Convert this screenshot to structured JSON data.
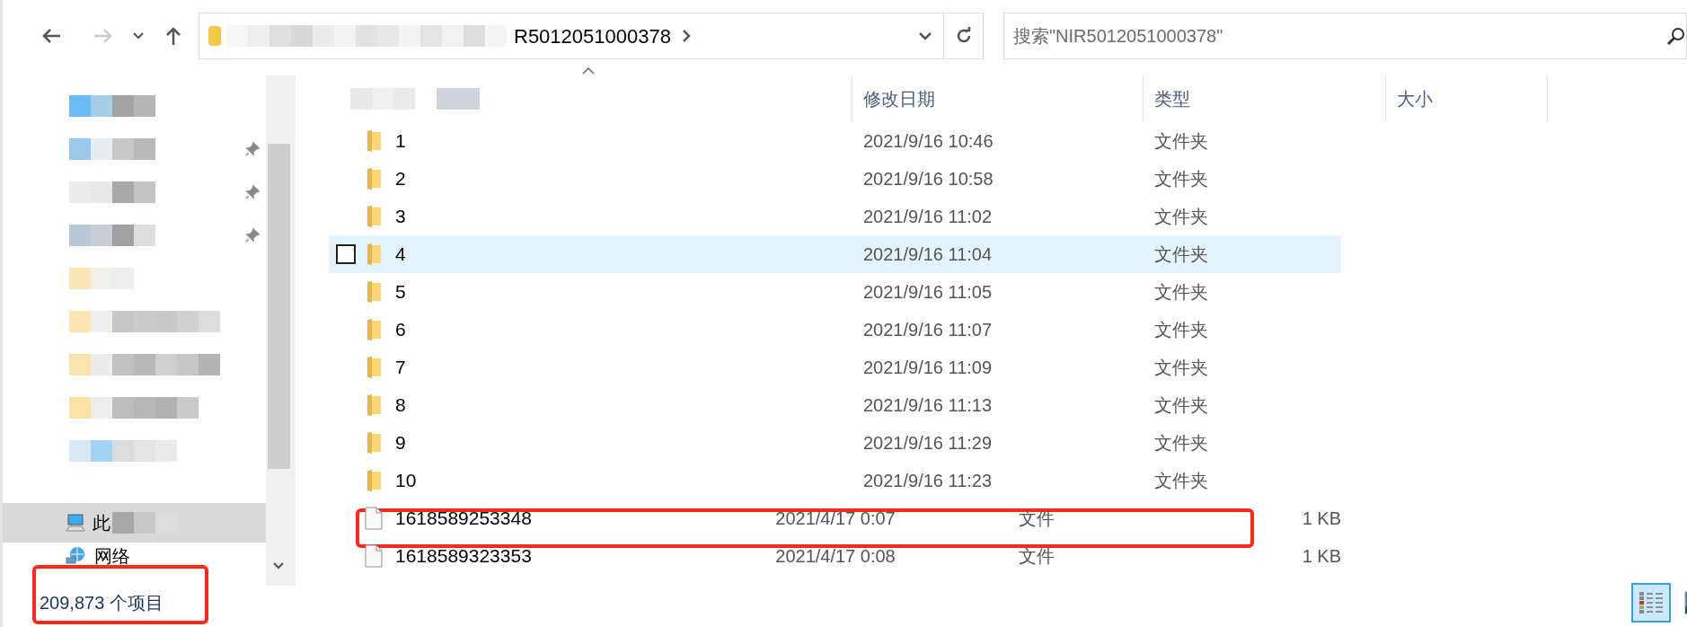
{
  "address_bar": {
    "path_visible": "R5012051000378"
  },
  "search": {
    "placeholder": "搜索\"NIR5012051000378\""
  },
  "sidebar": {
    "items": [
      {
        "label": "此",
        "kind": "computer",
        "selected": true
      },
      {
        "label": "网络",
        "kind": "network",
        "selected": false
      }
    ]
  },
  "columns": [
    "修改日期",
    "类型",
    "大小"
  ],
  "files": [
    {
      "name": "1",
      "modified": "2021/9/16 10:46",
      "type": "文件夹",
      "kind": "folder",
      "selected": false
    },
    {
      "name": "2",
      "modified": "2021/9/16 10:58",
      "type": "文件夹",
      "kind": "folder",
      "selected": false
    },
    {
      "name": "3",
      "modified": "2021/9/16 11:02",
      "type": "文件夹",
      "kind": "folder",
      "selected": false
    },
    {
      "name": "4",
      "modified": "2021/9/16 11:04",
      "type": "文件夹",
      "kind": "folder",
      "selected": true
    },
    {
      "name": "5",
      "modified": "2021/9/16 11:05",
      "type": "文件夹",
      "kind": "folder",
      "selected": false
    },
    {
      "name": "6",
      "modified": "2021/9/16 11:07",
      "type": "文件夹",
      "kind": "folder",
      "selected": false
    },
    {
      "name": "7",
      "modified": "2021/9/16 11:09",
      "type": "文件夹",
      "kind": "folder",
      "selected": false
    },
    {
      "name": "8",
      "modified": "2021/9/16 11:13",
      "type": "文件夹",
      "kind": "folder",
      "selected": false
    },
    {
      "name": "9",
      "modified": "2021/9/16 11:29",
      "type": "文件夹",
      "kind": "folder",
      "selected": false
    },
    {
      "name": "10",
      "modified": "2021/9/16 11:23",
      "type": "文件夹",
      "kind": "folder",
      "selected": false
    },
    {
      "name": "1618589253348",
      "modified": "2021/4/17 0:07",
      "type": "文件",
      "size": "1 KB",
      "kind": "file",
      "selected": false
    },
    {
      "name": "1618589323353",
      "modified": "2021/4/17 0:08",
      "type": "文件",
      "size": "1 KB",
      "kind": "file",
      "selected": false
    }
  ],
  "status_bar": {
    "item_count": "209,873 个项目"
  },
  "view_buttons": [
    {
      "kind": "details",
      "selected": true
    },
    {
      "kind": "thumbnails",
      "selected": false
    }
  ]
}
